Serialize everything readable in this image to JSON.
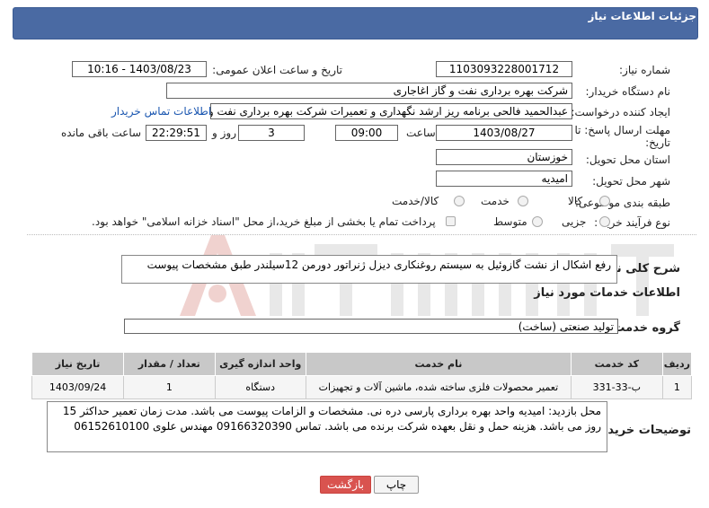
{
  "header": {
    "title": "جزئیات اطلاعات نیاز"
  },
  "form": {
    "need_number": {
      "label": "شماره نیاز:",
      "value": "1103093228001712"
    },
    "announce_datetime": {
      "label": "تاریخ و ساعت اعلان عمومی:",
      "value": "1403/08/23 - 10:16"
    },
    "buyer_org": {
      "label": "نام دستگاه خریدار:",
      "value": "شرکت بهره برداری نفت و گاز اغاجاری"
    },
    "requester": {
      "label": "ایجاد کننده درخواست:",
      "value": "عبدالحمید فالحی برنامه ریز ارشد نگهداری و تعمیرات شرکت بهره برداری نفت و",
      "contact_link": "اطلاعات تماس خریدار"
    },
    "deadline": {
      "label_line1": "مهلت ارسال پاسخ: تا",
      "label_line2": "تاریخ:",
      "date": "1403/08/27",
      "time_label": "ساعت",
      "time": "09:00",
      "days": "3",
      "days_label": "روز و",
      "remaining_time": "22:29:51",
      "remaining_label": "ساعت باقی مانده"
    },
    "province": {
      "label": "استان محل تحویل:",
      "value": "خوزستان"
    },
    "city": {
      "label": "شهر محل تحویل:",
      "value": "امیدیه"
    },
    "category": {
      "label": "طبقه بندی موضوعی:",
      "options": [
        "کالا",
        "خدمت",
        "کالا/خدمت"
      ]
    },
    "process_type": {
      "label": "نوع فرآیند خرید :",
      "options": [
        "جزیی",
        "متوسط"
      ],
      "payment_note": "پرداخت تمام یا بخشی از مبلغ خرید،از محل \"اسناد خزانه اسلامی\" خواهد بود."
    }
  },
  "summary": {
    "label": "شرح کلی نیاز:",
    "value": "رفع اشکال از نشت گازوئیل به سیستم روغنکاری دیزل ژنراتور دورمن 12سیلندر طبق مشخصات پیوست"
  },
  "services_section": {
    "title": "اطلاعات خدمات مورد نیاز",
    "group_label": "گروه خدمت:",
    "group_value": "تولید صنعتی (ساخت)"
  },
  "table": {
    "headers": [
      "ردیف",
      "کد خدمت",
      "نام خدمت",
      "واحد اندازه گیری",
      "تعداد / مقدار",
      "تاریخ نیاز"
    ],
    "rows": [
      [
        "1",
        "ب-33-331",
        "تعمیر محصولات فلزی ساخته شده، ماشین آلات و تجهیزات",
        "دستگاه",
        "1",
        "1403/09/24"
      ]
    ]
  },
  "buyer_notes": {
    "label": "توضیحات خریدار:",
    "value": "محل بازدید: امیدیه واحد بهره برداری پارسی دره نی. مشخصات و الزامات پیوست می باشد. مدت زمان تعمیر حداکثر 15 روز می باشد. هزینه حمل و نقل بعهده شرکت برنده می باشد. تماس 09166320390 مهندس علوی 06152610100"
  },
  "buttons": {
    "print": "چاپ",
    "back": "بازگشت"
  },
  "colors": {
    "header": "#4a6aa3",
    "back_button": "#d9534f",
    "link": "#1a56b0"
  }
}
